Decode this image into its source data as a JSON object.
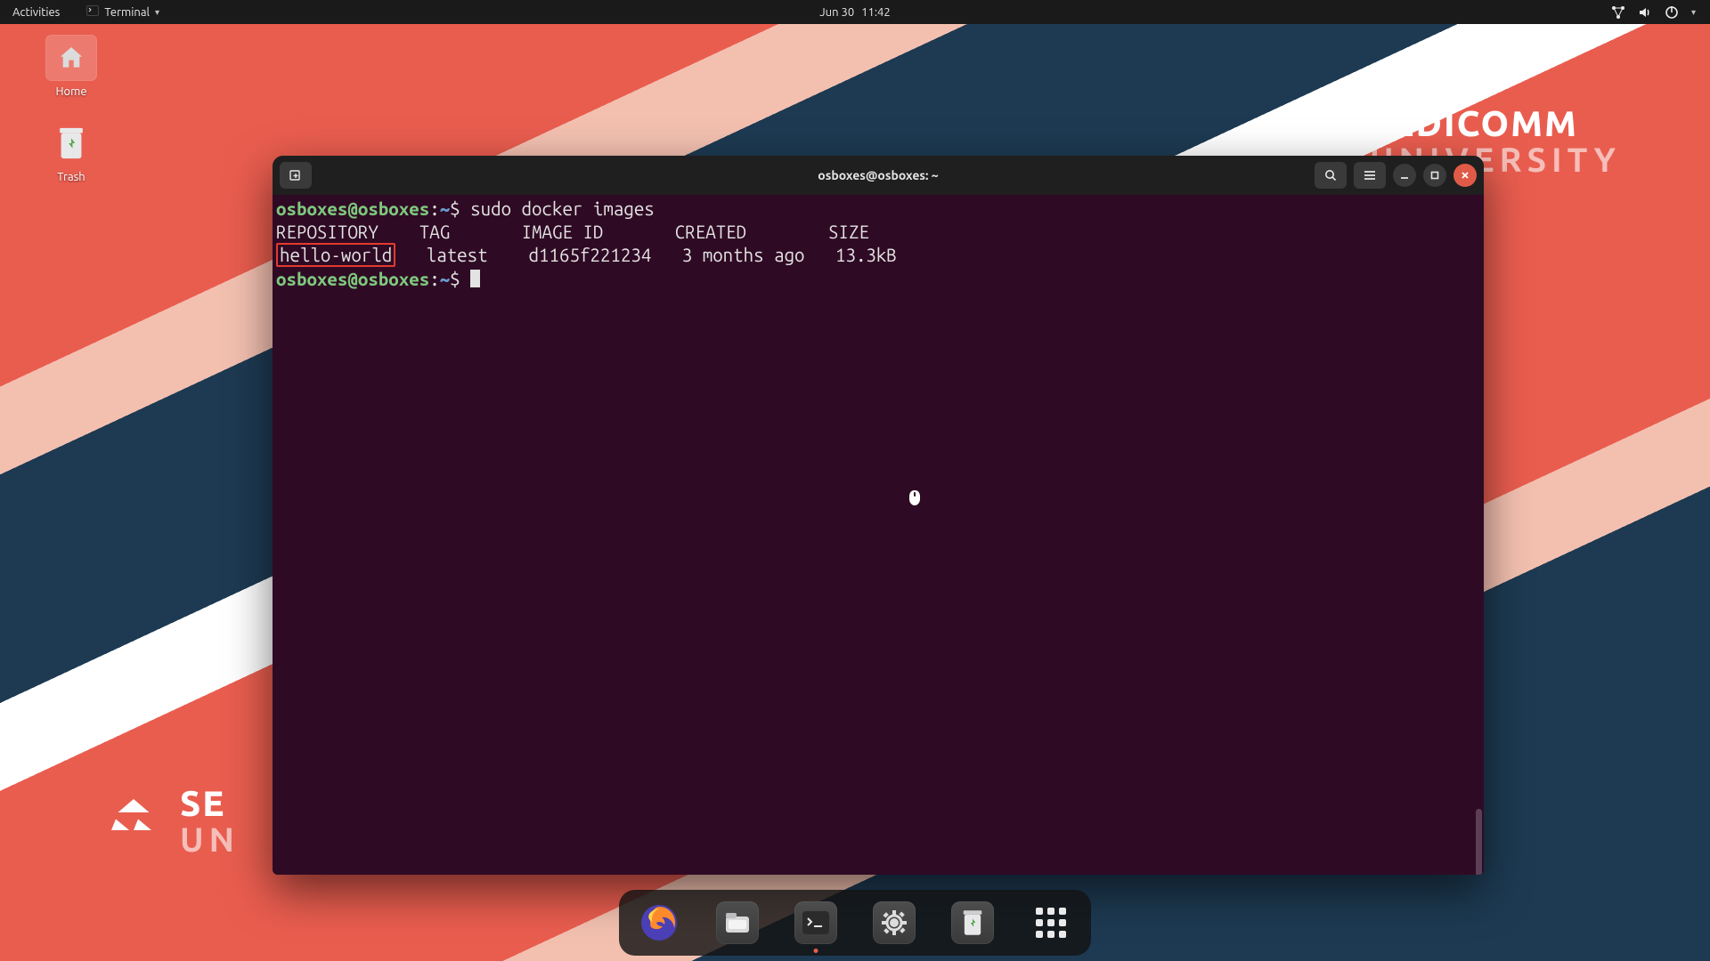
{
  "topbar": {
    "activities": "Activities",
    "app_name": "Terminal",
    "date": "Jun 30",
    "time": "11:42"
  },
  "desktop": {
    "home": "Home",
    "trash": "Trash"
  },
  "brand": {
    "name": "SEDICOMM",
    "sub": "UNIVERSITY",
    "name2": "SE",
    "sub2": "UN"
  },
  "terminal": {
    "title": "osboxes@osboxes: ~",
    "prompt_user": "osboxes@osboxes",
    "prompt_sep": ":",
    "prompt_path": "~",
    "prompt_sym": "$",
    "command": "sudo docker images",
    "headers": {
      "repository": "REPOSITORY",
      "tag": "TAG",
      "image_id": "IMAGE ID",
      "created": "CREATED",
      "size": "SIZE"
    },
    "row": {
      "repository": "hello-world",
      "tag": "latest",
      "image_id": "d1165f221234",
      "created": "3 months ago",
      "size": "13.3kB"
    }
  },
  "dock": {
    "firefox": "Firefox",
    "files": "Files",
    "terminal": "Terminal",
    "settings": "Settings",
    "trash": "Trash",
    "apps": "Show Applications"
  }
}
